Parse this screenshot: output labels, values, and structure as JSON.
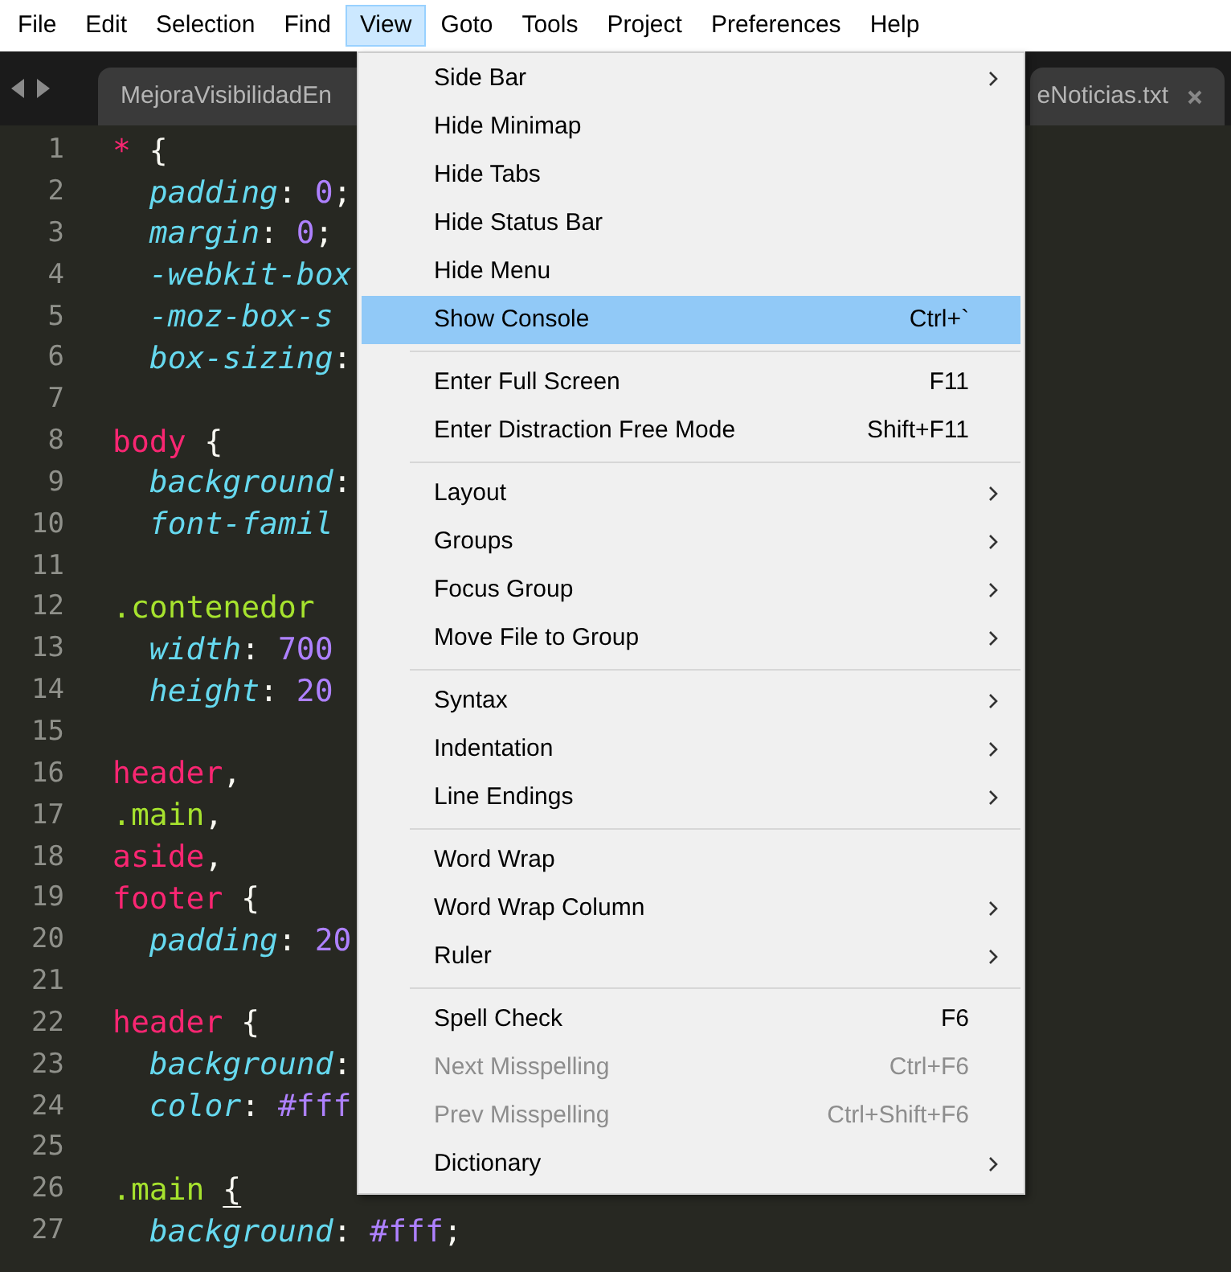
{
  "menu_bar": [
    {
      "label": "File",
      "selected": false
    },
    {
      "label": "Edit",
      "selected": false
    },
    {
      "label": "Selection",
      "selected": false
    },
    {
      "label": "Find",
      "selected": false
    },
    {
      "label": "View",
      "selected": true
    },
    {
      "label": "Goto",
      "selected": false
    },
    {
      "label": "Tools",
      "selected": false
    },
    {
      "label": "Project",
      "selected": false
    },
    {
      "label": "Preferences",
      "selected": false
    },
    {
      "label": "Help",
      "selected": false
    }
  ],
  "tabs": [
    {
      "label": "MejoraVisibilidadEn",
      "closable": false
    },
    {
      "label": "eNoticias.txt",
      "closable": true
    }
  ],
  "editor": {
    "lines": [
      {
        "number": "1",
        "tokens": [
          {
            "kind": "tag",
            "text": "*"
          },
          {
            "kind": "punct",
            "text": " {"
          }
        ]
      },
      {
        "number": "2",
        "tokens": [
          {
            "kind": "prop",
            "text": "  padding"
          },
          {
            "kind": "punct",
            "text": ": "
          },
          {
            "kind": "num",
            "text": "0"
          },
          {
            "kind": "punct",
            "text": ";"
          }
        ]
      },
      {
        "number": "3",
        "tokens": [
          {
            "kind": "prop",
            "text": "  margin"
          },
          {
            "kind": "punct",
            "text": ": "
          },
          {
            "kind": "num",
            "text": "0"
          },
          {
            "kind": "punct",
            "text": ";"
          }
        ]
      },
      {
        "number": "4",
        "tokens": [
          {
            "kind": "prop",
            "text": "  -webkit-box"
          }
        ]
      },
      {
        "number": "5",
        "tokens": [
          {
            "kind": "prop",
            "text": "  -moz-box-s"
          }
        ]
      },
      {
        "number": "6",
        "tokens": [
          {
            "kind": "prop",
            "text": "  box-sizing"
          },
          {
            "kind": "punct",
            "text": ":"
          }
        ]
      },
      {
        "number": "7"
      },
      {
        "number": "8",
        "tokens": [
          {
            "kind": "tag",
            "text": "body"
          },
          {
            "kind": "punct",
            "text": " {"
          }
        ]
      },
      {
        "number": "9",
        "tokens": [
          {
            "kind": "prop",
            "text": "  background"
          },
          {
            "kind": "punct",
            "text": ":"
          }
        ]
      },
      {
        "number": "10",
        "tokens": [
          {
            "kind": "prop",
            "text": "  font-famil"
          }
        ]
      },
      {
        "number": "11"
      },
      {
        "number": "12",
        "tokens": [
          {
            "kind": "class",
            "text": ".contenedor"
          }
        ]
      },
      {
        "number": "13",
        "tokens": [
          {
            "kind": "prop",
            "text": "  width"
          },
          {
            "kind": "punct",
            "text": ": "
          },
          {
            "kind": "num",
            "text": "700"
          }
        ]
      },
      {
        "number": "14",
        "tokens": [
          {
            "kind": "prop",
            "text": "  height"
          },
          {
            "kind": "punct",
            "text": ": "
          },
          {
            "kind": "num",
            "text": "20"
          }
        ]
      },
      {
        "number": "15"
      },
      {
        "number": "16",
        "tokens": [
          {
            "kind": "tag",
            "text": "header"
          },
          {
            "kind": "punct",
            "text": ","
          }
        ]
      },
      {
        "number": "17",
        "tokens": [
          {
            "kind": "class",
            "text": ".main"
          },
          {
            "kind": "punct",
            "text": ","
          }
        ]
      },
      {
        "number": "18",
        "tokens": [
          {
            "kind": "tag",
            "text": "aside"
          },
          {
            "kind": "punct",
            "text": ","
          }
        ]
      },
      {
        "number": "19",
        "tokens": [
          {
            "kind": "tag",
            "text": "footer"
          },
          {
            "kind": "punct",
            "text": " {"
          }
        ]
      },
      {
        "number": "20",
        "tokens": [
          {
            "kind": "prop",
            "text": "  padding"
          },
          {
            "kind": "punct",
            "text": ": "
          },
          {
            "kind": "num",
            "text": "20"
          }
        ]
      },
      {
        "number": "21"
      },
      {
        "number": "22",
        "tokens": [
          {
            "kind": "tag",
            "text": "header"
          },
          {
            "kind": "punct",
            "text": " {"
          }
        ]
      },
      {
        "number": "23",
        "tokens": [
          {
            "kind": "prop",
            "text": "  background"
          },
          {
            "kind": "punct",
            "text": ":"
          }
        ]
      },
      {
        "number": "24",
        "tokens": [
          {
            "kind": "prop",
            "text": "  color"
          },
          {
            "kind": "punct",
            "text": ": "
          },
          {
            "kind": "num",
            "text": "#fff"
          }
        ]
      },
      {
        "number": "25"
      },
      {
        "number": "26",
        "tokens": [
          {
            "kind": "class",
            "text": ".main"
          },
          {
            "kind": "brace-match",
            "text": "{"
          }
        ]
      },
      {
        "number": "27",
        "tokens": [
          {
            "kind": "prop",
            "text": "  background"
          },
          {
            "kind": "punct",
            "text": ": "
          },
          {
            "kind": "num",
            "text": "#fff"
          },
          {
            "kind": "punct",
            "text": ";"
          }
        ]
      }
    ]
  },
  "view_menu": {
    "groups": [
      [
        {
          "label": "Side Bar",
          "submenu": true,
          "disabled": false,
          "selected": false
        },
        {
          "label": "Hide Minimap",
          "submenu": false,
          "disabled": false,
          "selected": false
        },
        {
          "label": "Hide Tabs",
          "submenu": false,
          "disabled": false,
          "selected": false
        },
        {
          "label": "Hide Status Bar",
          "submenu": false,
          "disabled": false,
          "selected": false
        },
        {
          "label": "Hide Menu",
          "submenu": false,
          "disabled": false,
          "selected": false
        },
        {
          "label": "Show Console",
          "shortcut": "Ctrl+`",
          "submenu": false,
          "disabled": false,
          "selected": true
        }
      ],
      [
        {
          "label": "Enter Full Screen",
          "shortcut": "F11",
          "submenu": false,
          "disabled": false,
          "selected": false
        },
        {
          "label": "Enter Distraction Free Mode",
          "shortcut": "Shift+F11",
          "submenu": false,
          "disabled": false,
          "selected": false
        }
      ],
      [
        {
          "label": "Layout",
          "submenu": true,
          "disabled": false,
          "selected": false
        },
        {
          "label": "Groups",
          "submenu": true,
          "disabled": false,
          "selected": false
        },
        {
          "label": "Focus Group",
          "submenu": true,
          "disabled": false,
          "selected": false
        },
        {
          "label": "Move File to Group",
          "submenu": true,
          "disabled": false,
          "selected": false
        }
      ],
      [
        {
          "label": "Syntax",
          "submenu": true,
          "disabled": false,
          "selected": false
        },
        {
          "label": "Indentation",
          "submenu": true,
          "disabled": false,
          "selected": false
        },
        {
          "label": "Line Endings",
          "submenu": true,
          "disabled": false,
          "selected": false
        }
      ],
      [
        {
          "label": "Word Wrap",
          "submenu": false,
          "disabled": false,
          "selected": false
        },
        {
          "label": "Word Wrap Column",
          "submenu": true,
          "disabled": false,
          "selected": false
        },
        {
          "label": "Ruler",
          "submenu": true,
          "disabled": false,
          "selected": false
        }
      ],
      [
        {
          "label": "Spell Check",
          "shortcut": "F6",
          "submenu": false,
          "disabled": false,
          "selected": false
        },
        {
          "label": "Next Misspelling",
          "shortcut": "Ctrl+F6",
          "submenu": false,
          "disabled": true,
          "selected": false
        },
        {
          "label": "Prev Misspelling",
          "shortcut": "Ctrl+Shift+F6",
          "submenu": false,
          "disabled": true,
          "selected": false
        },
        {
          "label": "Dictionary",
          "submenu": true,
          "disabled": false,
          "selected": false
        }
      ]
    ]
  }
}
